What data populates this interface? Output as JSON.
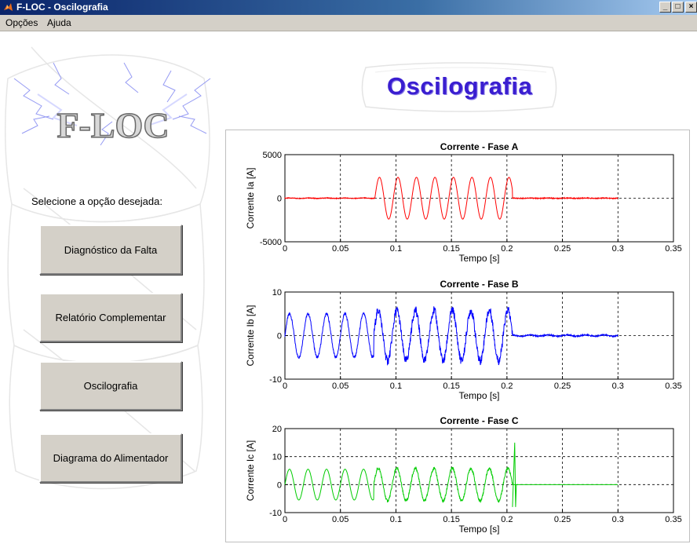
{
  "window": {
    "title": "F-LOC - Oscilografia",
    "controls": [
      "_",
      "□",
      "×"
    ]
  },
  "menu": {
    "items": [
      "Opções",
      "Ajuda"
    ]
  },
  "sidebar": {
    "logo_text": "F-LOC",
    "prompt": "Selecione a opção desejada:",
    "buttons": [
      {
        "label": "Diagnóstico da Falta"
      },
      {
        "label": "Relatório Complementar"
      },
      {
        "label": "Oscilografia"
      },
      {
        "label": "Diagrama do Alimentador"
      }
    ]
  },
  "header": {
    "title": "Oscilografia"
  },
  "chart_data": [
    {
      "type": "line",
      "title": "Corrente - Fase A",
      "xlabel": "Tempo [s]",
      "ylabel": "Corrente Ia [A]",
      "xlim": [
        0,
        0.35
      ],
      "ylim": [
        -5000,
        5000
      ],
      "xticks": [
        "0",
        "0.05",
        "0.1",
        "0.15",
        "0.2",
        "0.25",
        "0.3",
        "0.35"
      ],
      "yticks": [
        "5000",
        "0",
        "-5000"
      ],
      "ytick_values": [
        5000,
        0,
        -5000
      ],
      "grid": true,
      "color": "#ff0000",
      "signal": {
        "prefault_amp": 25,
        "fault_start": 0.081,
        "fault_end": 0.205,
        "fault_amp": 2400,
        "postfault_amp": 20,
        "end": 0.3,
        "frequency_hz": 60
      }
    },
    {
      "type": "line",
      "title": "Corrente - Fase B",
      "xlabel": "Tempo [s]",
      "ylabel": "Corrente Ib [A]",
      "xlim": [
        0,
        0.35
      ],
      "ylim": [
        -10,
        10
      ],
      "xticks": [
        "0",
        "0.05",
        "0.1",
        "0.15",
        "0.2",
        "0.25",
        "0.3",
        "0.35"
      ],
      "yticks": [
        "10",
        "0",
        "-10"
      ],
      "ytick_values": [
        10,
        0,
        -10
      ],
      "grid": true,
      "color": "#0000ff",
      "signal": {
        "prefault_amp": 5,
        "fault_start": 0.08,
        "fault_end": 0.205,
        "fault_amp": 5.8,
        "postfault_amp": 0.15,
        "end": 0.3,
        "frequency_hz": 60
      }
    },
    {
      "type": "line",
      "title": "Corrente - Fase C",
      "xlabel": "Tempo [s]",
      "ylabel": "Corrente Ic [A]",
      "xlim": [
        0,
        0.35
      ],
      "ylim": [
        -10,
        20
      ],
      "xticks": [
        "0",
        "0.05",
        "0.1",
        "0.15",
        "0.2",
        "0.25",
        "0.3",
        "0.35"
      ],
      "yticks": [
        "20",
        "10",
        "0",
        "-10"
      ],
      "ytick_values": [
        20,
        10,
        0,
        -10
      ],
      "grid": true,
      "color": "#00cc00",
      "signal": {
        "prefault_amp": 5.5,
        "fault_start": 0.08,
        "fault_end": 0.205,
        "fault_amp": 5.8,
        "postfault_amp": 0,
        "spike_peak": 15,
        "end": 0.3,
        "frequency_hz": 60
      }
    }
  ]
}
